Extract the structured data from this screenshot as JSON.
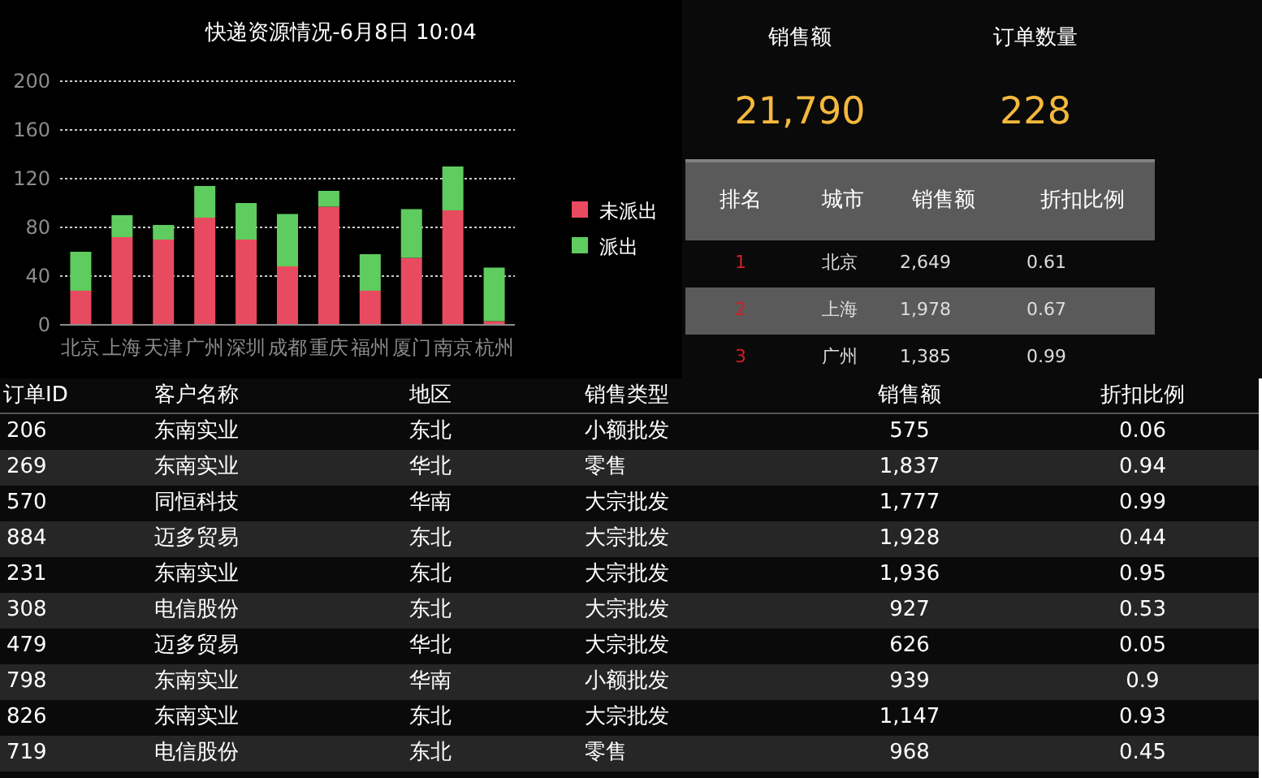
{
  "chart": {
    "title": "快递资源情况-6月8日 10:04",
    "chart_data": {
      "type": "bar",
      "stacked": true,
      "grid": true,
      "legend": true,
      "categories": [
        "北京",
        "上海",
        "天津",
        "广州",
        "深圳",
        "成都",
        "重庆",
        "福州",
        "厦门",
        "南京",
        "杭州"
      ],
      "ylim": [
        0,
        200
      ],
      "yticks": [
        0,
        40,
        80,
        120,
        160,
        200
      ],
      "series": [
        {
          "name": "未派出",
          "color": "#e84b5f",
          "values": [
            28,
            72,
            70,
            88,
            70,
            48,
            97,
            28,
            55,
            94,
            3
          ]
        },
        {
          "name": "派出",
          "color": "#5fcc5f",
          "values": [
            32,
            18,
            12,
            26,
            30,
            43,
            13,
            30,
            40,
            36,
            44
          ]
        }
      ]
    }
  },
  "kpis": [
    {
      "label": "销售额",
      "value": "21,790"
    },
    {
      "label": "订单数量",
      "value": "228"
    }
  ],
  "ranking": {
    "columns": [
      "排名",
      "城市",
      "销售额",
      "折扣比例"
    ],
    "rows": [
      {
        "rank": "1",
        "city": "北京",
        "sales": "2,649",
        "discount": "0.61"
      },
      {
        "rank": "2",
        "city": "上海",
        "sales": "1,978",
        "discount": "0.67"
      },
      {
        "rank": "3",
        "city": "广州",
        "sales": "1,385",
        "discount": "0.99"
      }
    ]
  },
  "orders": {
    "columns": [
      "订单ID",
      "客户名称",
      "地区",
      "销售类型",
      "销售额",
      "折扣比例"
    ],
    "rows": [
      [
        "206",
        "东南实业",
        "东北",
        "小额批发",
        "575",
        "0.06"
      ],
      [
        "269",
        "东南实业",
        "华北",
        "零售",
        "1,837",
        "0.94"
      ],
      [
        "570",
        "同恒科技",
        "华南",
        "大宗批发",
        "1,777",
        "0.99"
      ],
      [
        "884",
        "迈多贸易",
        "东北",
        "大宗批发",
        "1,928",
        "0.44"
      ],
      [
        "231",
        "东南实业",
        "东北",
        "大宗批发",
        "1,936",
        "0.95"
      ],
      [
        "308",
        "电信股份",
        "东北",
        "大宗批发",
        "927",
        "0.53"
      ],
      [
        "479",
        "迈多贸易",
        "华北",
        "大宗批发",
        "626",
        "0.05"
      ],
      [
        "798",
        "东南实业",
        "华南",
        "小额批发",
        "939",
        "0.9"
      ],
      [
        "826",
        "东南实业",
        "东北",
        "大宗批发",
        "1,147",
        "0.93"
      ],
      [
        "719",
        "电信股份",
        "东北",
        "零售",
        "968",
        "0.45"
      ]
    ]
  }
}
